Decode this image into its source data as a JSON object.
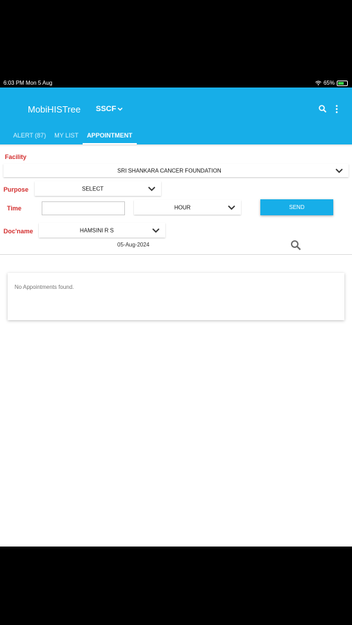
{
  "status_bar": {
    "time_date": "6:03 PM   Mon 5 Aug",
    "battery": "65%"
  },
  "app_bar": {
    "title": "MobiHISTree",
    "facility_code": "SSCF",
    "icons": [
      "search-icon",
      "more-vert-icon"
    ],
    "color": "#17aee8"
  },
  "tabs": [
    {
      "label": "ALERT (87)",
      "active": false
    },
    {
      "label": "MY LIST",
      "active": false
    },
    {
      "label": "APPOINTMENT",
      "active": true
    }
  ],
  "form": {
    "facility_label": "Facility",
    "facility_value": "SRI SHANKARA CANCER FOUNDATION",
    "purpose_label": "Purpose",
    "purpose_value": "SELECT",
    "time_label": "Time",
    "time_value": "",
    "hour_value": "HOUR",
    "send_label": "SEND",
    "docname_label": "Doc'name",
    "docname_value": "HAMSINI R S",
    "date": "05-Aug-2024"
  },
  "results": {
    "empty_message": "No Appointments found."
  }
}
